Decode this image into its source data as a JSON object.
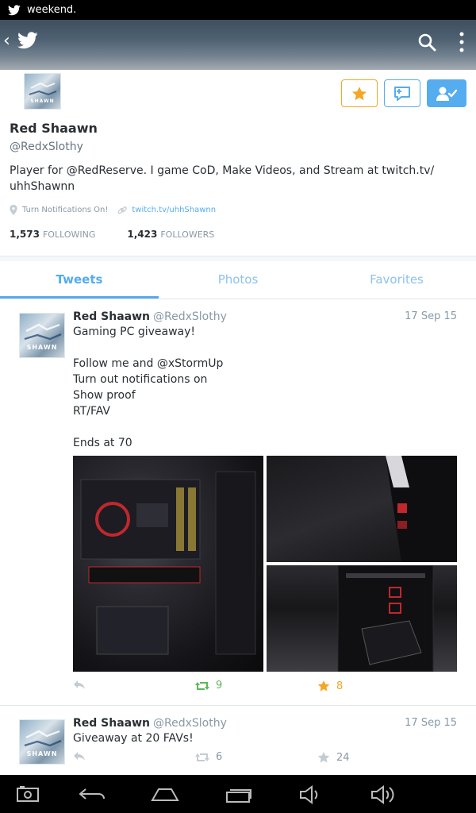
{
  "status_bar": {
    "text": "weekend."
  },
  "profile": {
    "name": "Red Shaawn",
    "handle": "@RedxSlothy",
    "bio": "Player for @RedReserve. I game CoD, Make Videos, and Stream at twitch.tv/ uhhShawnn",
    "location": "Turn Notifications On!",
    "url": "twitch.tv/uhhShawnn",
    "following_count": "1,573",
    "following_label": "FOLLOWING",
    "followers_count": "1,423",
    "followers_label": "FOLLOWERS",
    "avatar_text": "SHAWN"
  },
  "tabs": [
    {
      "label": "Tweets",
      "active": true
    },
    {
      "label": "Photos",
      "active": false
    },
    {
      "label": "Favorites",
      "active": false
    }
  ],
  "tweets": [
    {
      "name": "Red Shaawn",
      "handle": "@RedxSlothy",
      "date": "17 Sep 15",
      "text": "Gaming PC giveaway!\n\nFollow me and @xStormUp\nTurn out notifications on\nShow proof\nRT/FAV\n\nEnds at 70",
      "retweets": "9",
      "favorites": "8"
    },
    {
      "name": "Red Shaawn",
      "handle": "@RedxSlothy",
      "date": "17 Sep 15",
      "text": "Giveaway at 20 FAVs!",
      "retweets": "6",
      "favorites": "24"
    }
  ],
  "colors": {
    "accent": "#55acee",
    "favorite": "#f5a623",
    "retweet": "#5cb85c",
    "muted": "#8899a6"
  },
  "icons": {
    "status": "twitter-bird-icon",
    "header": [
      "back-icon",
      "twitter-logo-icon",
      "search-icon",
      "more-icon"
    ],
    "actions": [
      "reply-icon",
      "retweet-icon",
      "favorite-icon"
    ],
    "nav": [
      "screenshot-icon",
      "back-nav-icon",
      "home-icon",
      "recents-icon",
      "volume-down-icon",
      "volume-up-icon"
    ]
  }
}
